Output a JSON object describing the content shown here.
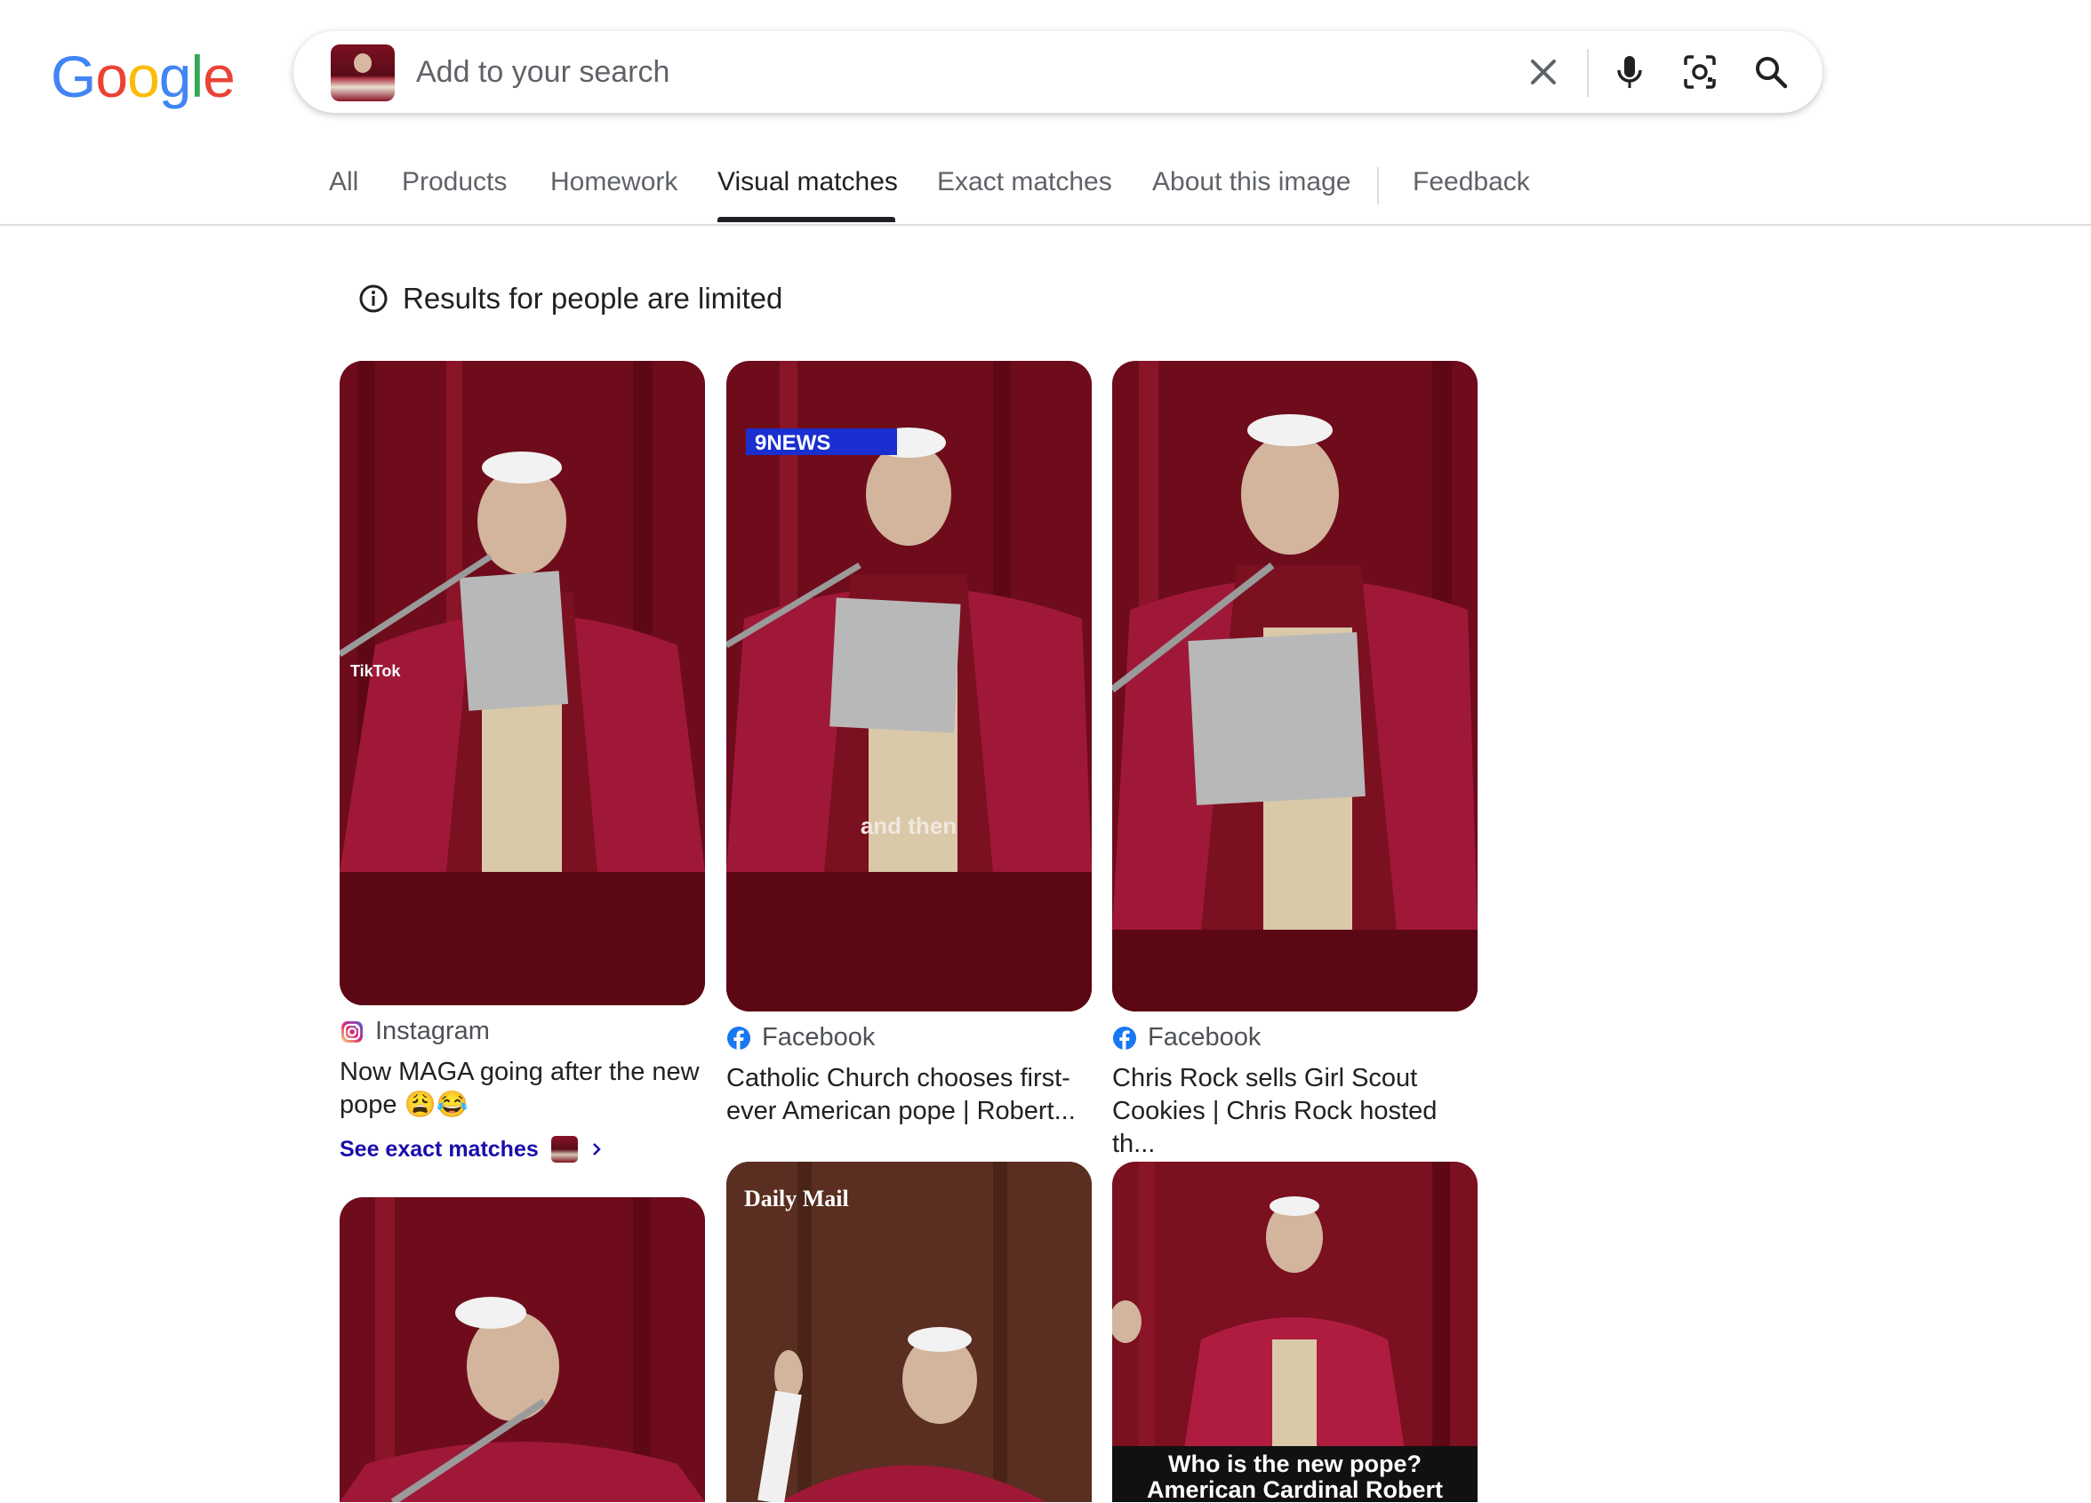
{
  "logo": {
    "text": "Google"
  },
  "search": {
    "placeholder": "Add to your search"
  },
  "tabs": [
    {
      "label": "All"
    },
    {
      "label": "Products"
    },
    {
      "label": "Homework"
    },
    {
      "label": "Visual matches"
    },
    {
      "label": "Exact matches"
    },
    {
      "label": "About this image"
    },
    {
      "label": "Feedback"
    }
  ],
  "notice": {
    "text": "Results for people are limited"
  },
  "results": [
    {
      "source": "Instagram",
      "title": "Now MAGA going after the new pope 😩😂",
      "exact_label": "See exact matches",
      "overlay": "TikTok"
    },
    {
      "source": "Facebook",
      "title": "Catholic Church chooses first-ever American pope | Robert...",
      "overlay_badge": "9NEWS",
      "overlay": "and then"
    },
    {
      "source": "Facebook",
      "title": "Chris Rock sells Girl Scout Cookies | Chris Rock hosted th..."
    },
    {
      "source": "",
      "title": ""
    },
    {
      "source": "",
      "title": "",
      "overlay_badge": "Daily Mail"
    },
    {
      "source": "",
      "title": "",
      "overlay": "Who is the new pope? American Cardinal Robert"
    }
  ],
  "colors": {
    "accent_text": "#1a0dab",
    "google_blue": "#4285F4",
    "google_red": "#EA4335",
    "google_yellow": "#FBBC05",
    "google_green": "#34A853"
  }
}
